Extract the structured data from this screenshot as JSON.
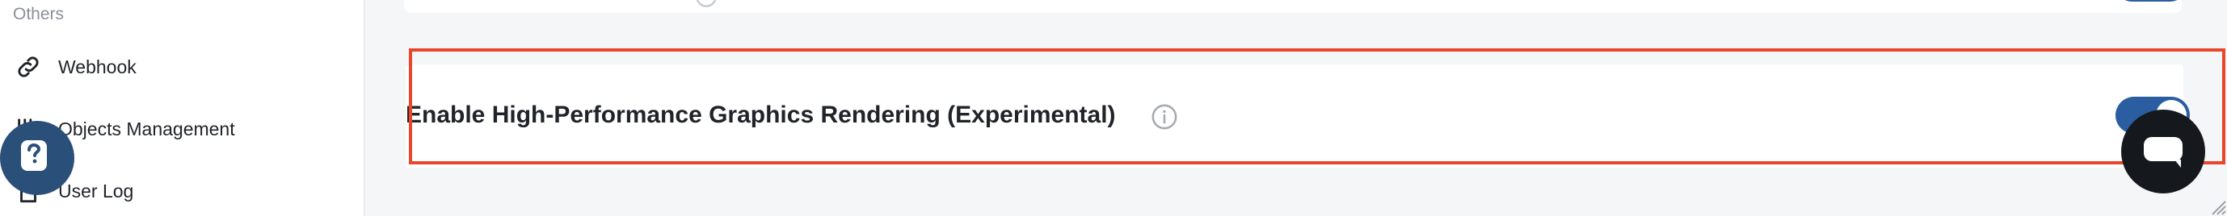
{
  "sidebar": {
    "section_title": "Others",
    "items": [
      {
        "label": "Webhook",
        "icon": "link-icon"
      },
      {
        "label": "Objects Management",
        "icon": "objects-icon"
      },
      {
        "label": "User Log",
        "icon": "document-icon"
      }
    ]
  },
  "settings": {
    "main_item": {
      "label": "Enable High-Performance Graphics Rendering (Experimental)",
      "enabled": true,
      "highlighted": true
    }
  },
  "colors": {
    "toggle_on": "#2a5ea1",
    "highlight": "#e8472c",
    "help_bubble": "#2a4f79",
    "chat_bubble": "#15191e"
  }
}
